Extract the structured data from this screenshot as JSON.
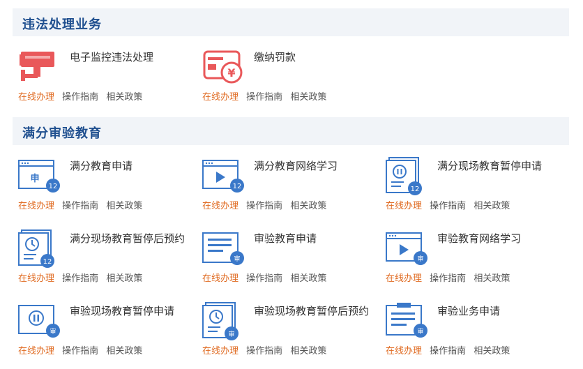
{
  "sections": [
    {
      "title": "违法处理业务"
    },
    {
      "title": "满分审验教育"
    }
  ],
  "link_labels": {
    "online": "在线办理",
    "guide": "操作指南",
    "policy": "相关政策"
  },
  "badges": {
    "twelve": "12",
    "shen": "审",
    "shen_char": "申"
  },
  "colors": {
    "accent_orange": "#e06b22",
    "header_blue": "#1f4f8f",
    "icon_blue": "#3a78c9",
    "icon_red": "#e9585a"
  },
  "items": [
    {
      "name": "电子监控违法处理",
      "icon": "camera-icon"
    },
    {
      "name": "缴纳罚款",
      "icon": "payment-card-icon"
    },
    {
      "name": "满分教育申请",
      "icon": "application-window-icon"
    },
    {
      "name": "满分教育网络学习",
      "icon": "video-window-icon"
    },
    {
      "name": "满分现场教育暂停申请",
      "icon": "pause-document-icon"
    },
    {
      "name": "满分现场教育暂停后预约",
      "icon": "clock-document-icon"
    },
    {
      "name": "审验教育申请",
      "icon": "document-lines-icon"
    },
    {
      "name": "审验教育网络学习",
      "icon": "video-window-icon"
    },
    {
      "name": "审验现场教育暂停申请",
      "icon": "pause-window-icon"
    },
    {
      "name": "审验现场教育暂停后预约",
      "icon": "clock-document-icon"
    },
    {
      "name": "审验业务申请",
      "icon": "clipboard-lines-icon"
    }
  ]
}
